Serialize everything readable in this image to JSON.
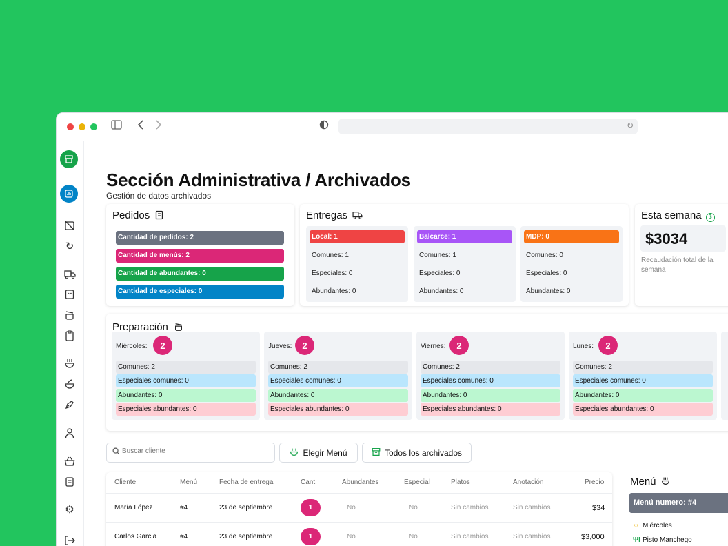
{
  "sidebar": {
    "icons": [
      "store-icon",
      "chart-icon",
      "calendar-off-icon",
      "refresh-icon",
      "truck-icon",
      "shopping-bag-icon",
      "pot-icon",
      "clipboard-icon",
      "bowl-icon",
      "salad-icon",
      "pen-icon",
      "user-icon",
      "basket-icon",
      "scroll-icon",
      "settings-icon",
      "logout-icon"
    ]
  },
  "header": {
    "title": "Sección Administrativa / Archivados",
    "subtitle": "Gestión de datos archivados"
  },
  "pedidos": {
    "title": "Pedidos",
    "items": [
      {
        "label": "Cantidad de pedidos: 2",
        "color": "#6b7280"
      },
      {
        "label": "Cantidad de menús: 2",
        "color": "#db2777"
      },
      {
        "label": "Cantidad de abundantes: 0",
        "color": "#16a34a"
      },
      {
        "label": "Cantidad de especiales: 0",
        "color": "#0284c7"
      }
    ]
  },
  "entregas": {
    "title": "Entregas",
    "groups": [
      {
        "head": "Local: 1",
        "color": "#ef4444",
        "comunes": "Comunes: 1",
        "especiales": "Especiales: 0",
        "abundantes": "Abundantes: 0"
      },
      {
        "head": "Balcarce: 1",
        "color": "#a855f7",
        "comunes": "Comunes: 1",
        "especiales": "Especiales: 0",
        "abundantes": "Abundantes: 0"
      },
      {
        "head": "MDP: 0",
        "color": "#f97316",
        "comunes": "Comunes: 0",
        "especiales": "Especiales: 0",
        "abundantes": "Abundantes: 0"
      }
    ]
  },
  "semana": {
    "title": "Esta semana",
    "amount": "$3034",
    "caption": "Recaudación total de la semana"
  },
  "preparacion": {
    "title": "Preparación",
    "days": [
      {
        "day": "Miércoles:",
        "count": "2",
        "comunes": "Comunes: 2",
        "esp_comunes": "Especiales comunes: 0",
        "abundantes": "Abundantes: 0",
        "esp_abundantes": "Especiales abundantes: 0"
      },
      {
        "day": "Jueves:",
        "count": "2",
        "comunes": "Comunes: 2",
        "esp_comunes": "Especiales comunes: 0",
        "abundantes": "Abundantes: 0",
        "esp_abundantes": "Especiales abundantes: 0"
      },
      {
        "day": "Viernes:",
        "count": "2",
        "comunes": "Comunes: 2",
        "esp_comunes": "Especiales comunes: 0",
        "abundantes": "Abundantes: 0",
        "esp_abundantes": "Especiales abundantes: 0"
      },
      {
        "day": "Lunes:",
        "count": "2",
        "comunes": "Comunes: 2",
        "esp_comunes": "Especiales comunes: 0",
        "abundantes": "Abundantes: 0",
        "esp_abundantes": "Especiales abundantes: 0"
      }
    ],
    "row_colors": {
      "comunes": "#e5e7eb",
      "esp_comunes": "#bae6fd",
      "abundantes": "#bbf7d0",
      "esp_abundantes": "#fecdd3"
    }
  },
  "toolbar": {
    "search_placeholder": "Buscar cliente",
    "elegir_menu": "Elegir Menú",
    "todos_archivados": "Todos los archivados"
  },
  "table": {
    "headers": [
      "Cliente",
      "Menú",
      "Fecha de entrega",
      "Cant",
      "Abundantes",
      "Especial",
      "Platos",
      "Anotación",
      "Precio"
    ],
    "rows": [
      {
        "cliente": "María López",
        "menu": "#4",
        "fecha": "23 de septiembre",
        "cant": "1",
        "abundantes": "No",
        "especial": "No",
        "platos": "Sin cambios",
        "anotacion": "Sin cambios",
        "precio": "$34"
      },
      {
        "cliente": "Carlos Garcia",
        "menu": "#4",
        "fecha": "23 de septiembre",
        "cant": "1",
        "abundantes": "No",
        "especial": "No",
        "platos": "Sin cambios",
        "anotacion": "Sin cambios",
        "precio": "$3,000"
      }
    ]
  },
  "menu_panel": {
    "title": "Menú",
    "head": "Menú numero: #4",
    "day": "Miércoles",
    "dish": "Pisto Manchego"
  }
}
